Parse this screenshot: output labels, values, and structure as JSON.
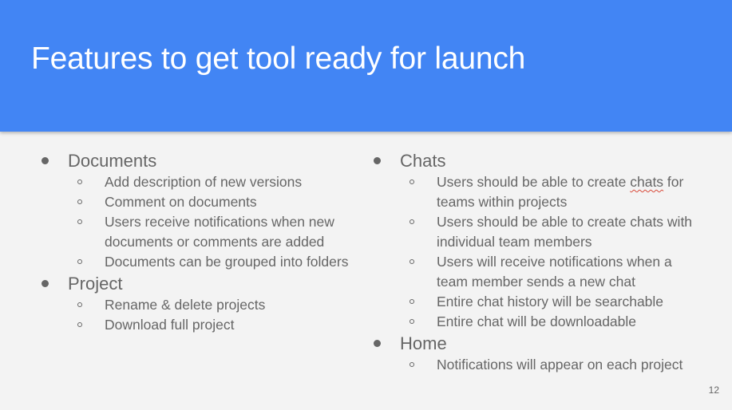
{
  "slide": {
    "title": "Features to get tool ready for launch",
    "page_number": "12",
    "colors": {
      "header_bg": "#4285f4",
      "title_text": "#ffffff",
      "body_text": "#666666",
      "background": "#f3f3f3"
    },
    "left": [
      {
        "label": "Documents",
        "items": [
          "Add description of new versions",
          "Comment on documents",
          "Users receive notifications when new documents or comments are added",
          "Documents can be grouped into folders"
        ]
      },
      {
        "label": "Project",
        "items": [
          "Rename & delete projects",
          "Download full project"
        ]
      }
    ],
    "right": [
      {
        "label": "Chats",
        "items": [
          "Users should be able to create chats for teams within projects",
          "Users should be able to create chats with individual team members",
          "Users will receive notifications when a team member sends a new chat",
          "Entire chat history will be searchable",
          "Entire chat will be downloadable"
        ]
      },
      {
        "label": "Home",
        "items": [
          "Notifications will appear on each project"
        ]
      }
    ]
  }
}
